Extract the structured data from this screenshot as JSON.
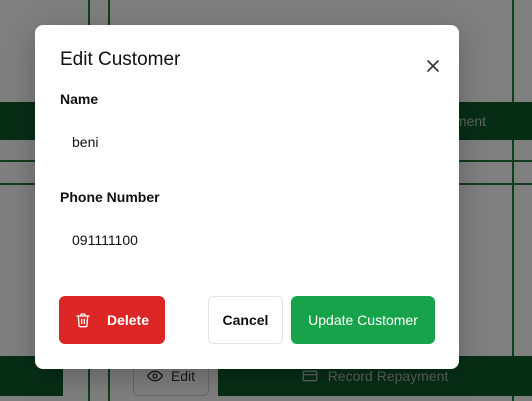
{
  "background": {
    "edit_label": "Edit",
    "record_repayment_label": "Record Repayment",
    "partial_repayment_label": "ment"
  },
  "modal": {
    "title": "Edit Customer",
    "close_icon": "close-icon",
    "name_field": {
      "label": "Name",
      "value": "beni"
    },
    "phone_field": {
      "label": "Phone Number",
      "value": "091111100"
    },
    "delete_button": {
      "label": "Delete",
      "icon": "trash-icon"
    },
    "cancel_button": {
      "label": "Cancel"
    },
    "update_button": {
      "label": "Update Customer"
    }
  },
  "colors": {
    "danger": "#dc2626",
    "primary": "#16a34a",
    "overlay": "rgba(0,0,0,0.5)",
    "background_accent": "#0f5c2b"
  }
}
